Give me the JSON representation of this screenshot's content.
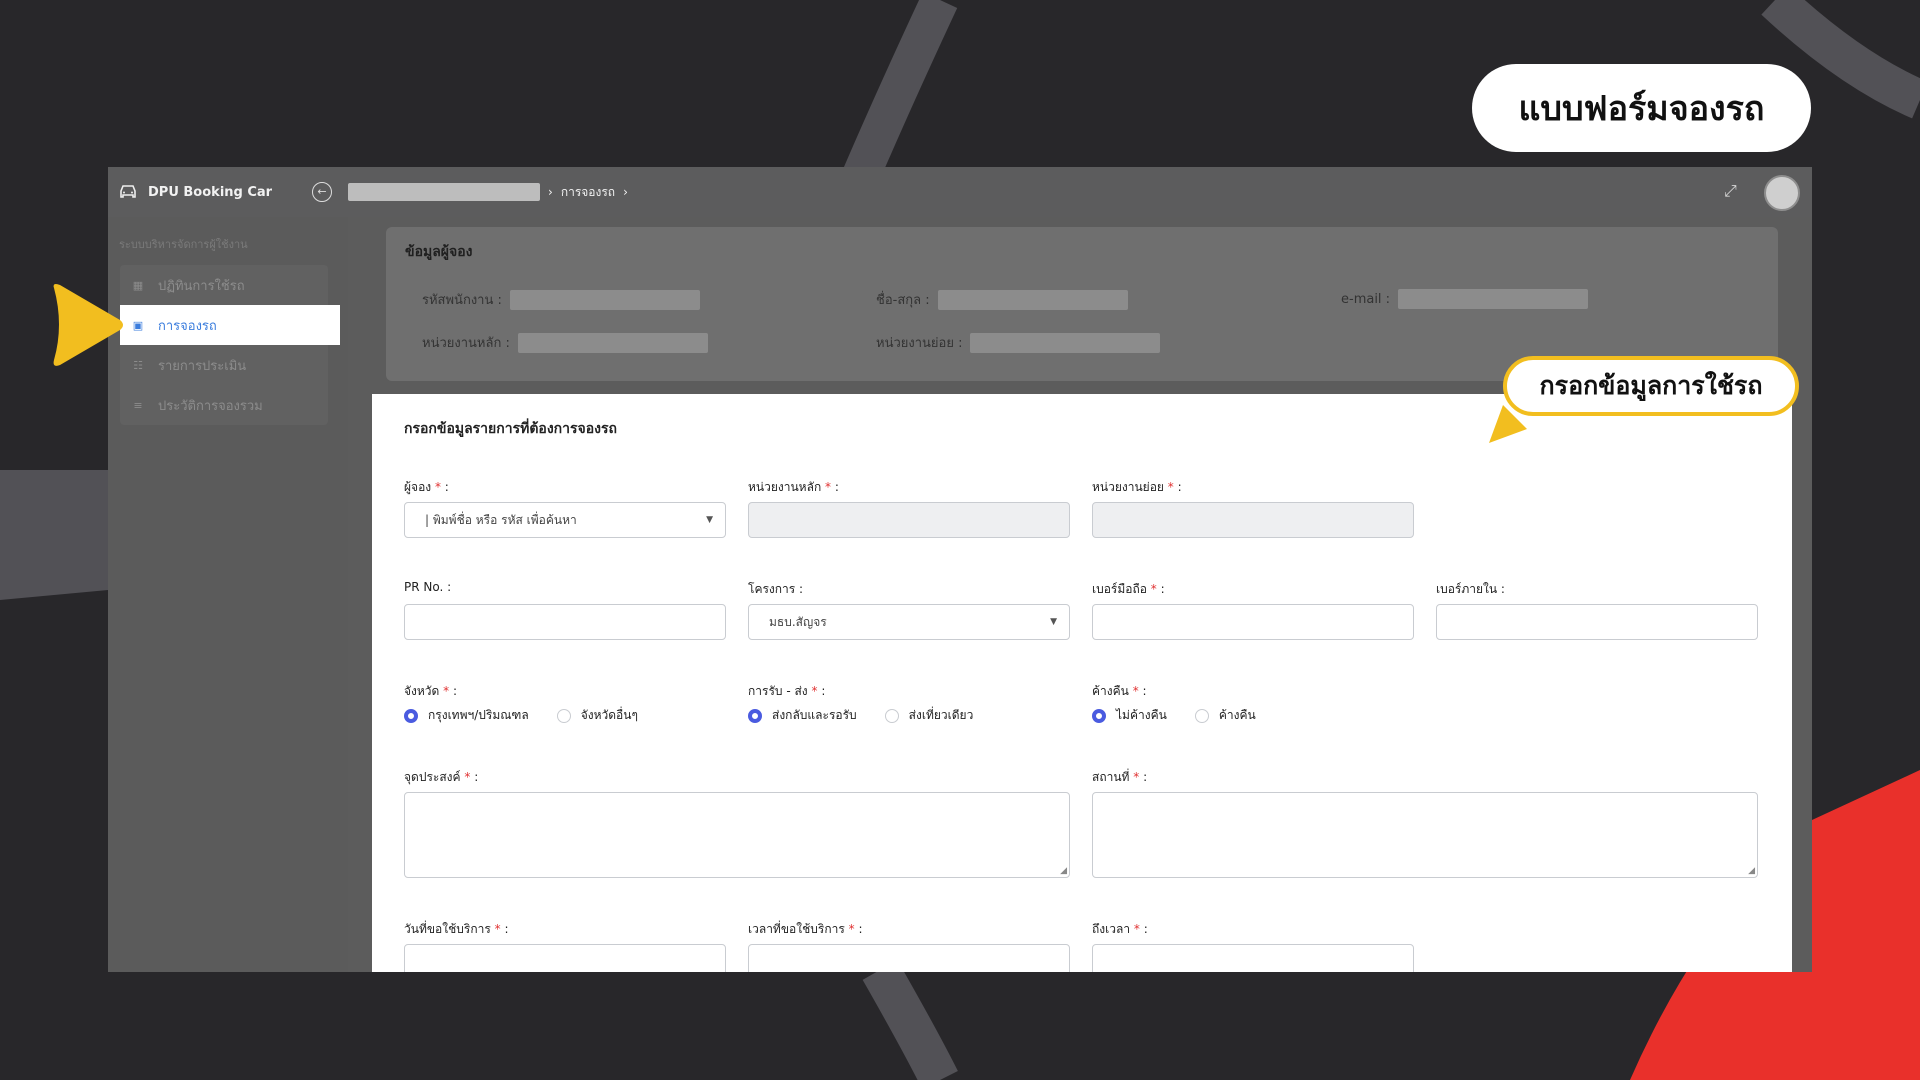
{
  "banner": {
    "title": "แบบฟอร์มจองรถ",
    "hint": "กรอกข้อมูลการใช้รถ"
  },
  "app": {
    "brand": "DPU Booking Car",
    "breadcrumb_current": "การจองรถ",
    "sidebar": {
      "caption": "ระบบบริหารจัดการผู้ใช้งาน",
      "items": [
        {
          "label": "ปฏิทินการใช้รถ",
          "icon": "calendar-icon"
        },
        {
          "label": "การจองรถ",
          "icon": "booking-icon",
          "active": true
        },
        {
          "label": "รายการประเมิน",
          "icon": "list-check-icon"
        },
        {
          "label": "ประวัติการจองรวม",
          "icon": "history-list-icon"
        }
      ]
    },
    "booker_info": {
      "title": "ข้อมูลผู้จอง",
      "employee_id_label": "รหัสพนักงาน :",
      "fullname_label": "ชื่อ-สกุล :",
      "email_label": "e-mail :",
      "main_unit_label": "หน่วยงานหลัก :",
      "sub_unit_label": "หน่วยงานย่อย :"
    },
    "form": {
      "title": "กรอกข้อมูลรายการที่ต้องการจองรถ",
      "booker_label": "ผู้จอง",
      "booker_placeholder": "| พิมพ์ชื่อ หรือ รหัส เพื่อค้นหา",
      "main_unit_label": "หน่วยงานหลัก",
      "sub_unit_label": "หน่วยงานย่อย",
      "pr_label": "PR No. :",
      "project_label": "โครงการ :",
      "project_value": "มธบ.สัญจร",
      "mobile_label": "เบอร์มือถือ",
      "internal_label": "เบอร์ภายใน :",
      "province_label": "จังหวัด",
      "province_opt1": "กรุงเทพฯ/ปริมณฑล",
      "province_opt2": "จังหวัดอื่นๆ",
      "transfer_label": "การรับ - ส่ง",
      "transfer_opt1": "ส่งกลับและรอรับ",
      "transfer_opt2": "ส่งเที่ยวเดียว",
      "overnight_label": "ค้างคืน",
      "overnight_opt1": "ไม่ค้างคืน",
      "overnight_opt2": "ค้างคืน",
      "purpose_label": "จุดประสงค์",
      "place_label": "สถานที่",
      "date_label": "วันที่ขอใช้บริการ",
      "time_label": "เวลาที่ขอใช้บริการ",
      "until_label": "ถึงเวลา",
      "required_mark": "*",
      "colon": ":"
    }
  },
  "colors": {
    "background": "#28272a",
    "accent_yellow": "#f2be1f",
    "accent_red": "#e9302b",
    "active_link": "#3b7ddd",
    "radio_on": "#4a5be0"
  }
}
